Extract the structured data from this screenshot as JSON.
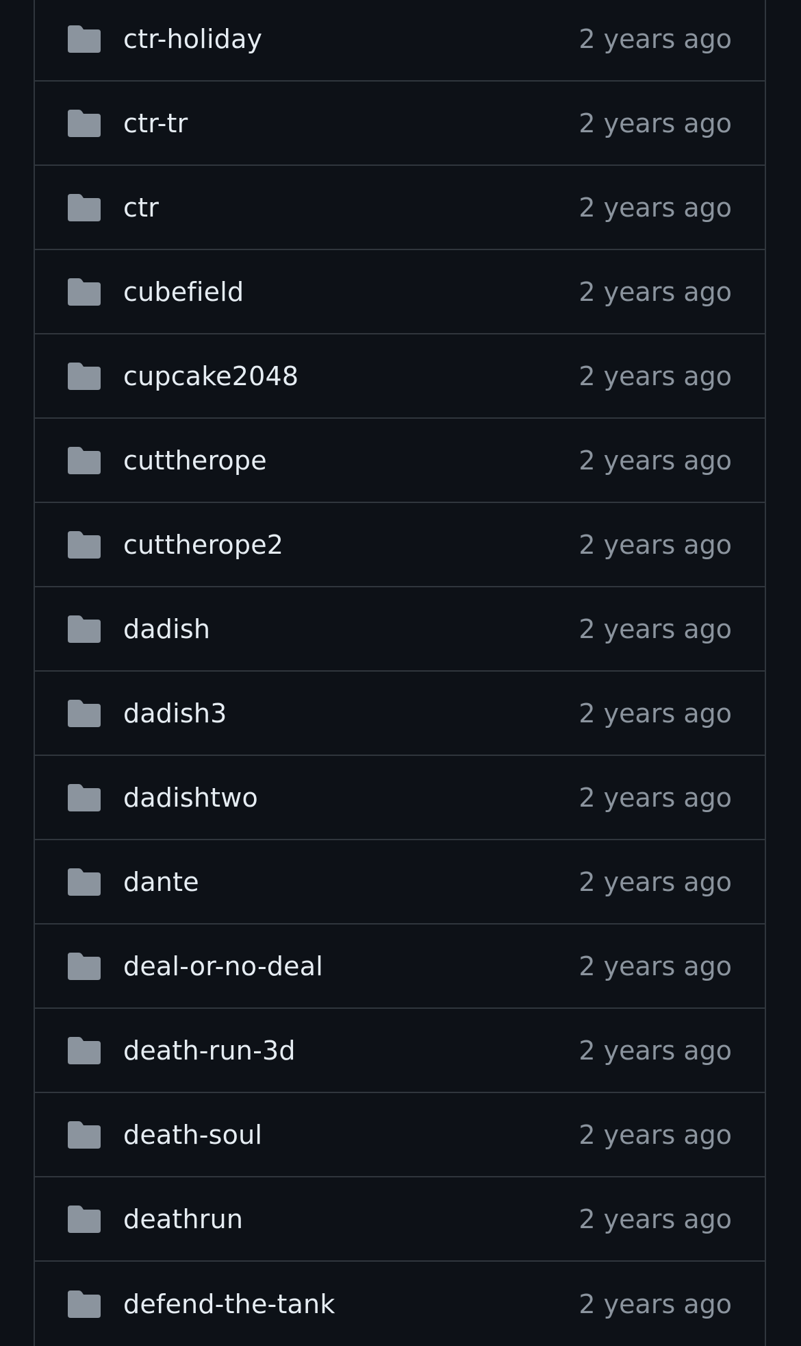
{
  "icons": {
    "folder": "folder-icon"
  },
  "colors": {
    "background": "#0d1117",
    "border": "#30363d",
    "folder_icon": "#8b949e",
    "name_text": "#e6edf3",
    "time_text": "#8b949e"
  },
  "files": [
    {
      "name": "ctr-holiday",
      "time": "2 years ago"
    },
    {
      "name": "ctr-tr",
      "time": "2 years ago"
    },
    {
      "name": "ctr",
      "time": "2 years ago"
    },
    {
      "name": "cubefield",
      "time": "2 years ago"
    },
    {
      "name": "cupcake2048",
      "time": "2 years ago"
    },
    {
      "name": "cuttherope",
      "time": "2 years ago"
    },
    {
      "name": "cuttherope2",
      "time": "2 years ago"
    },
    {
      "name": "dadish",
      "time": "2 years ago"
    },
    {
      "name": "dadish3",
      "time": "2 years ago"
    },
    {
      "name": "dadishtwo",
      "time": "2 years ago"
    },
    {
      "name": "dante",
      "time": "2 years ago"
    },
    {
      "name": "deal-or-no-deal",
      "time": "2 years ago"
    },
    {
      "name": "death-run-3d",
      "time": "2 years ago"
    },
    {
      "name": "death-soul",
      "time": "2 years ago"
    },
    {
      "name": "deathrun",
      "time": "2 years ago"
    },
    {
      "name": "defend-the-tank",
      "time": "2 years ago"
    }
  ]
}
